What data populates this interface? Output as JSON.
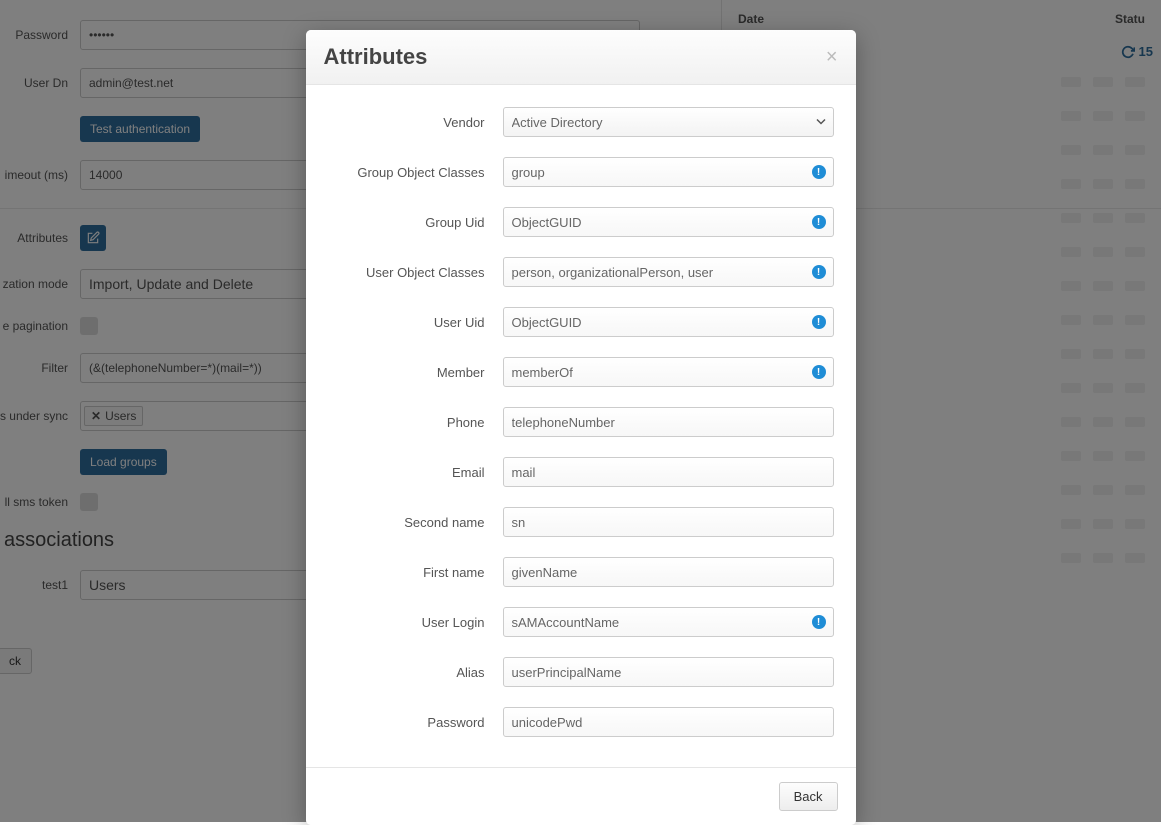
{
  "bg": {
    "password_label": "Password",
    "password_value": "******",
    "userdn_label": "User Dn",
    "userdn_value": "admin@test.net",
    "test_auth_btn": "Test authentication",
    "timeout_label": "imeout (ms)",
    "timeout_value": "14000",
    "attributes_label": "Attributes",
    "sync_mode_label": "zation mode",
    "sync_mode_value": "Import, Update and Delete",
    "pagination_label": "e pagination",
    "filter_label": "Filter",
    "filter_value": "(&(telephoneNumber=*)(mail=*))",
    "groups_sync_label": "s under sync",
    "groups_tag": "Users",
    "load_groups_btn": "Load groups",
    "sms_token_label": "ll sms token",
    "associations_title": " associations",
    "assoc_link": "test1",
    "assoc_value": "Users",
    "back_btn": "ck",
    "table": {
      "date_col": "Date",
      "status_col": "Statu",
      "refresh_num": "15"
    }
  },
  "modal": {
    "title": "Attributes",
    "fields": {
      "vendor": {
        "label": "Vendor",
        "value": "Active Directory"
      },
      "group_obj": {
        "label": "Group Object Classes",
        "value": "group",
        "info": true
      },
      "group_uid": {
        "label": "Group Uid",
        "value": "ObjectGUID",
        "info": true
      },
      "user_obj": {
        "label": "User Object Classes",
        "value": "person, organizationalPerson, user",
        "info": true
      },
      "user_uid": {
        "label": "User Uid",
        "value": "ObjectGUID",
        "info": true
      },
      "member": {
        "label": "Member",
        "value": "memberOf",
        "info": true
      },
      "phone": {
        "label": "Phone",
        "value": "telephoneNumber",
        "info": false
      },
      "email": {
        "label": "Email",
        "value": "mail",
        "info": false
      },
      "second_name": {
        "label": "Second name",
        "value": "sn",
        "info": false
      },
      "first_name": {
        "label": "First name",
        "value": "givenName",
        "info": false
      },
      "user_login": {
        "label": "User Login",
        "value": "sAMAccountName",
        "info": true
      },
      "alias": {
        "label": "Alias",
        "value": "userPrincipalName",
        "info": false
      },
      "password": {
        "label": "Password",
        "value": "unicodePwd",
        "info": false
      }
    },
    "back_btn": "Back"
  }
}
